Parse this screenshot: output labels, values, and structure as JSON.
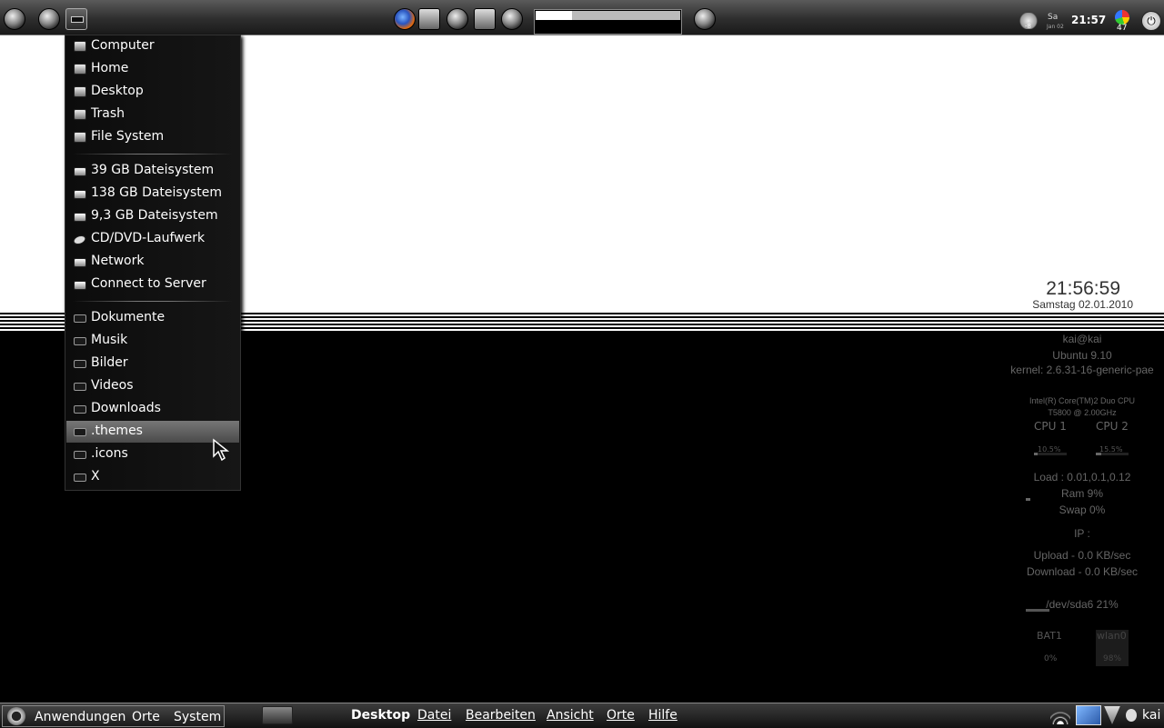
{
  "top_panel": {
    "icons": [
      "system-monitor-icon",
      "gimp-icon",
      "places-menu-icon",
      "firefox-icon",
      "network-tools-icon",
      "terminal-icon",
      "file-icon",
      "music-icon",
      "volume-icon"
    ],
    "progress_fraction": 0.25,
    "tray": {
      "weather_temp": "-8",
      "day": "Sa",
      "date": "Jan 02",
      "clock": "21:57",
      "gauge_value": "47"
    }
  },
  "places_menu": {
    "section_locations": [
      "Computer",
      "Home",
      "Desktop",
      "Trash",
      "File System"
    ],
    "section_devices": [
      "39 GB Dateisystem",
      "138 GB Dateisystem",
      "9,3 GB Dateisystem",
      "CD/DVD-Laufwerk",
      "Network",
      "Connect to Server"
    ],
    "section_bookmarks": [
      "Dokumente",
      "Musik",
      "Bilder",
      "Videos",
      "Downloads",
      ".themes",
      ".icons",
      "X"
    ],
    "selected": ".themes"
  },
  "desktop_clock": {
    "time": "21:56:59",
    "date": "Samstag 02.01.2010"
  },
  "conky": {
    "user": "kai@kai",
    "os": "Ubuntu 9.10",
    "kernel": "kernel: 2.6.31-16-generic-pae",
    "cpu_model_1": "Intel(R) Core(TM)2 Duo CPU",
    "cpu_model_2": "T5800  @ 2.00GHz",
    "cpu1_label": "CPU 1",
    "cpu2_label": "CPU 2",
    "cpu1_value": "10.5%",
    "cpu2_value": "15.5%",
    "cpu1_fraction": 0.105,
    "cpu2_fraction": 0.155,
    "load": "Load : 0.01,0.1,0.12",
    "ram": "Ram 9%",
    "swap": "Swap 0%",
    "ip": "IP :",
    "upload": "Upload - 0.0 KB/sec",
    "download": "Download - 0.0 KB/sec",
    "disk": "/dev/sda6 21%",
    "bat_label": "BAT1",
    "bat_value": "0%",
    "wlan_label": "wlan0",
    "wlan_value": "98%"
  },
  "bottom_panel": {
    "main_menus": [
      "Anwendungen",
      "Orte",
      "System"
    ],
    "app_title": "Desktop",
    "app_menus": [
      "Datei",
      "Bearbeiten",
      "Ansicht",
      "Orte",
      "Hilfe"
    ],
    "username": "kai"
  }
}
